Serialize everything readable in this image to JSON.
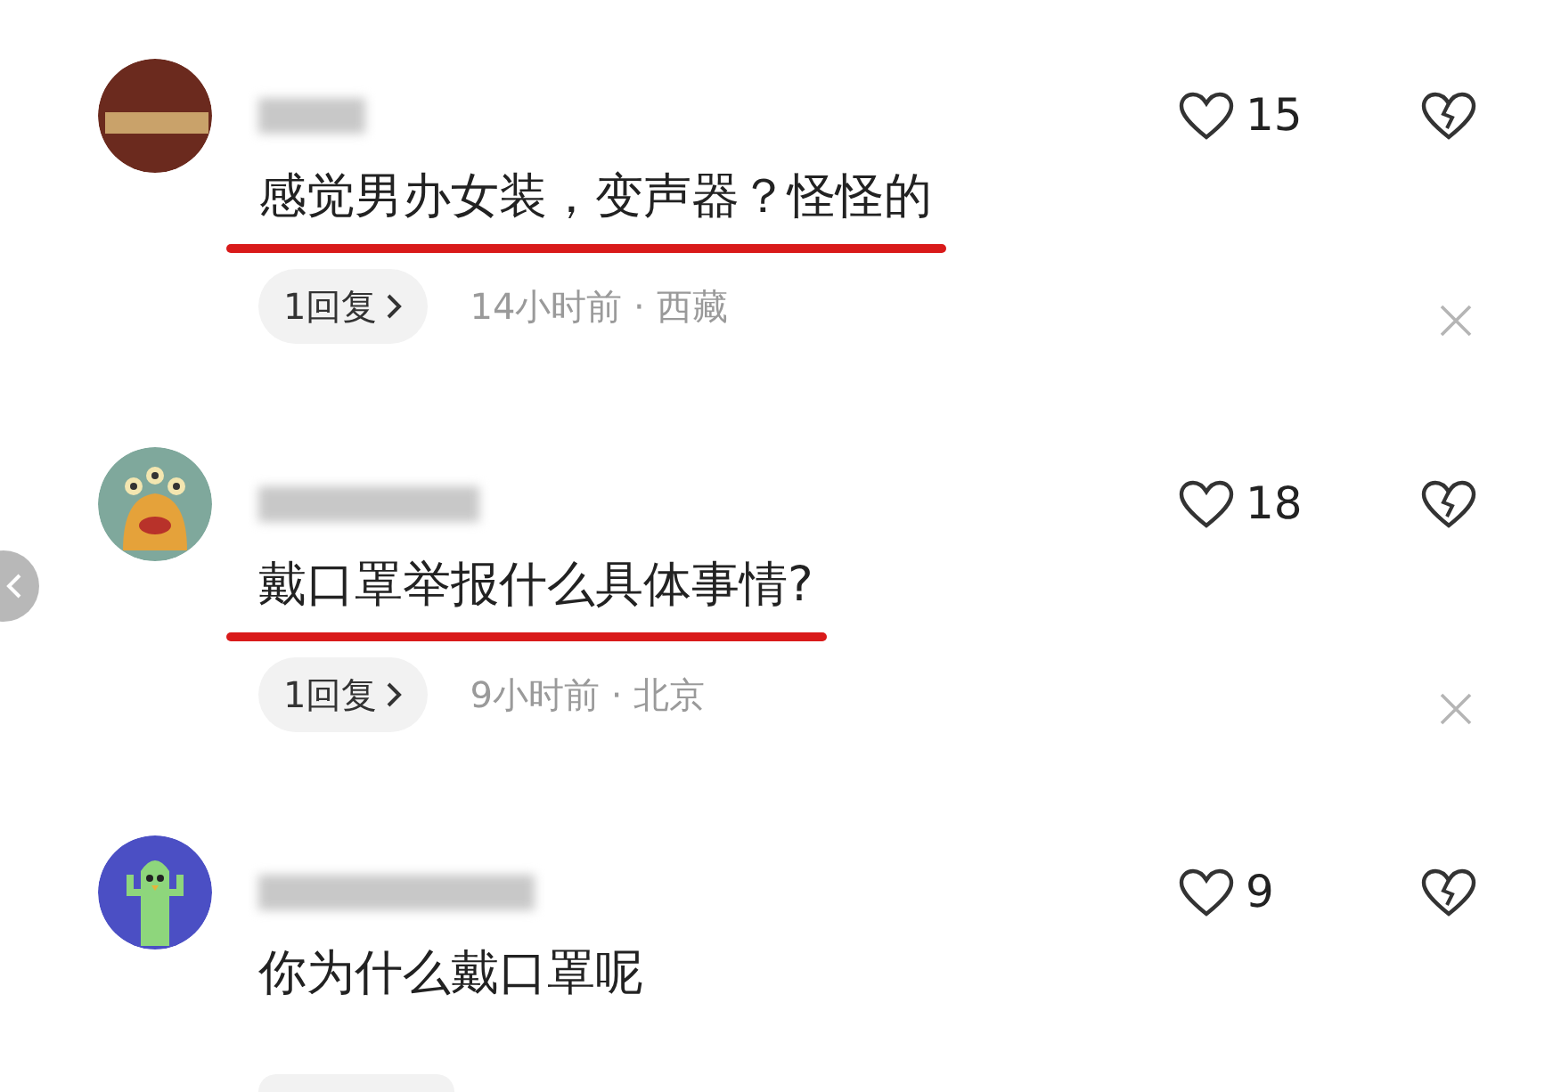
{
  "comments": [
    {
      "avatar": {
        "kind": "photo"
      },
      "text": "感觉男办女装，变声器？怪怪的",
      "underlined": true,
      "likes": "15",
      "replies": "1回复",
      "time": "14小时前 · 西藏"
    },
    {
      "avatar": {
        "kind": "monster"
      },
      "text": "戴口罩举报什么具体事情?",
      "underlined": true,
      "likes": "18",
      "replies": "1回复",
      "time": "9小时前 · 北京"
    },
    {
      "avatar": {
        "kind": "cactus"
      },
      "text": "你为什么戴口罩呢",
      "underlined": false,
      "likes": "9"
    }
  ]
}
